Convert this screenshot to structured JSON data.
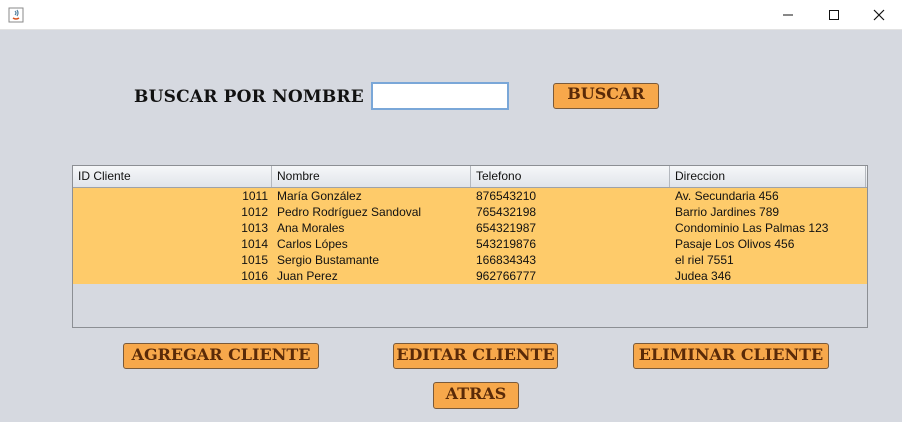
{
  "search": {
    "label": "BUSCAR POR NOMBRE :",
    "value": "",
    "button_label": "BUSCAR"
  },
  "table": {
    "columns": [
      "ID Cliente",
      "Nombre",
      "Telefono",
      "Direccion"
    ],
    "rows": [
      [
        "1011",
        "María González",
        "876543210",
        "Av. Secundaria 456"
      ],
      [
        "1012",
        "Pedro Rodríguez Sandoval",
        "765432198",
        "Barrio Jardines 789"
      ],
      [
        "1013",
        "Ana Morales",
        "654321987",
        "Condominio Las Palmas 123"
      ],
      [
        "1014",
        "Carlos Lópes",
        "543219876",
        "Pasaje Los Olivos 456"
      ],
      [
        "1015",
        "Sergio Bustamante",
        "166834343",
        "el riel 7551"
      ],
      [
        "1016",
        "Juan Perez",
        "962766777",
        "Judea 346"
      ]
    ]
  },
  "actions": {
    "add": "AGREGAR CLIENTE",
    "edit": "EDITAR CLIENTE",
    "delete": "ELIMINAR CLIENTE",
    "back": "ATRAS"
  },
  "colors": {
    "button": "#f7a84b",
    "row_highlight": "#fecb6a",
    "background": "#d6d9e0"
  },
  "icons": {
    "app": "java-icon",
    "minimize": "minimize-icon",
    "maximize": "maximize-icon",
    "close": "close-icon"
  }
}
